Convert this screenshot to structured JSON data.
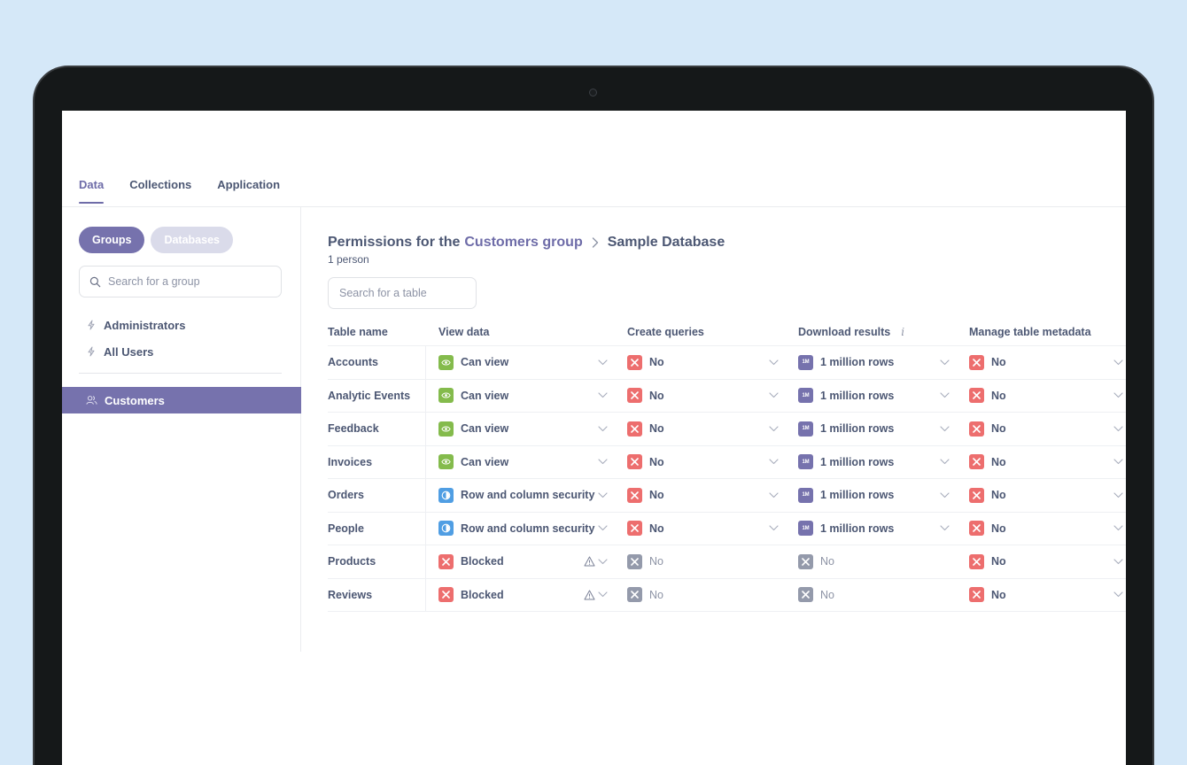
{
  "tabs": [
    {
      "label": "Data",
      "active": true
    },
    {
      "label": "Collections",
      "active": false
    },
    {
      "label": "Application",
      "active": false
    }
  ],
  "sidebar": {
    "toggle_groups": "Groups",
    "toggle_databases": "Databases",
    "search_placeholder": "Search for a group",
    "groups": [
      "Administrators",
      "All Users"
    ],
    "active_group": "Customers"
  },
  "main": {
    "heading_prefix": "Permissions for the",
    "heading_group": "Customers group",
    "heading_database": "Sample Database",
    "subtitle": "1 person",
    "table_search_placeholder": "Search for a table",
    "columns": [
      "Table name",
      "View data",
      "Create queries",
      "Download results",
      "Manage table metadata"
    ],
    "download_info_icon": "i",
    "rows": [
      {
        "name": "Accounts",
        "view": "Can view",
        "view_icon": "eye-icon",
        "queries": "No",
        "queries_disabled": false,
        "download": "1 million rows",
        "download_icon": "1M",
        "download_disabled": false,
        "metadata": "No",
        "warning": false
      },
      {
        "name": "Analytic Events",
        "view": "Can view",
        "view_icon": "eye-icon",
        "queries": "No",
        "queries_disabled": false,
        "download": "1 million rows",
        "download_icon": "1M",
        "download_disabled": false,
        "metadata": "No",
        "warning": false
      },
      {
        "name": "Feedback",
        "view": "Can view",
        "view_icon": "eye-icon",
        "queries": "No",
        "queries_disabled": false,
        "download": "1 million rows",
        "download_icon": "1M",
        "download_disabled": false,
        "metadata": "No",
        "warning": false
      },
      {
        "name": "Invoices",
        "view": "Can view",
        "view_icon": "eye-icon",
        "queries": "No",
        "queries_disabled": false,
        "download": "1 million rows",
        "download_icon": "1M",
        "download_disabled": false,
        "metadata": "No",
        "warning": false
      },
      {
        "name": "Orders",
        "view": "Row and column security",
        "view_icon": "security-icon",
        "queries": "No",
        "queries_disabled": false,
        "download": "1 million rows",
        "download_icon": "1M",
        "download_disabled": false,
        "metadata": "No",
        "warning": false
      },
      {
        "name": "People",
        "view": "Row and column security",
        "view_icon": "security-icon",
        "queries": "No",
        "queries_disabled": false,
        "download": "1 million rows",
        "download_icon": "1M",
        "download_disabled": false,
        "metadata": "No",
        "warning": false
      },
      {
        "name": "Products",
        "view": "Blocked",
        "view_icon": "blocked-icon",
        "queries": "No",
        "queries_disabled": true,
        "download": "No",
        "download_icon": "",
        "download_disabled": true,
        "metadata": "No",
        "warning": true
      },
      {
        "name": "Reviews",
        "view": "Blocked",
        "view_icon": "blocked-icon",
        "queries": "No",
        "queries_disabled": true,
        "download": "No",
        "download_icon": "",
        "download_disabled": true,
        "metadata": "No",
        "warning": true
      }
    ]
  },
  "colors": {
    "accent": "#7672ad",
    "green": "#84bb4c",
    "red": "#ed6e6e",
    "grey": "#949aab",
    "blue": "#509ee3"
  }
}
